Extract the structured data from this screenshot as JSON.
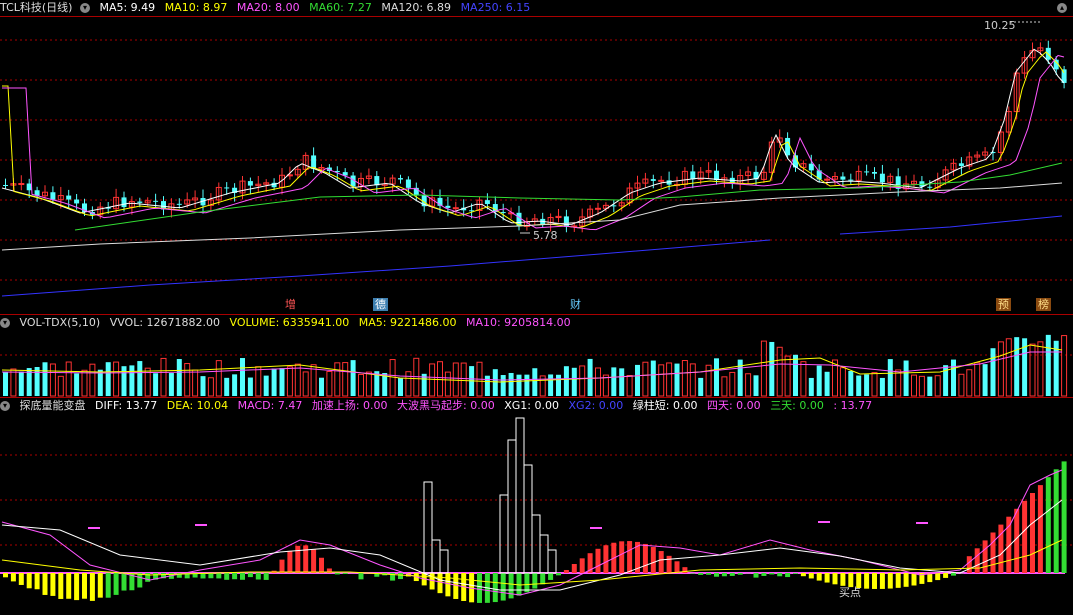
{
  "main_header": {
    "title": "TCL科技(日线)",
    "ma5": "MA5: 9.49",
    "ma10": "MA10: 8.97",
    "ma20": "MA20: 8.00",
    "ma60": "MA60: 7.27",
    "ma120": "MA120: 6.89",
    "ma250": "MA250: 6.15"
  },
  "main_annotations": {
    "high": "10.25",
    "low": "5.78",
    "marker_zeng": "增",
    "marker_de": "德",
    "marker_cai": "财",
    "marker_yu": "预",
    "marker_bang": "榜"
  },
  "vol_header": {
    "title": "VOL-TDX(5,10)",
    "vvol": "VVOL: 12671882.00",
    "volume": "VOLUME: 6335941.00",
    "ma5": "MA5: 9221486.00",
    "ma10": "MA10: 9205814.00"
  },
  "ind_header": {
    "title": "探底量能变盘",
    "diff": "DIFF: 13.77",
    "dea": "DEA: 10.04",
    "macd": "MACD: 7.47",
    "jiasu": "加速上扬: 0.00",
    "dabo": "大波黑马起步: 0.00",
    "xg1": "XG1: 0.00",
    "xg2": "XG2: 0.00",
    "lvzhu": "绿柱短: 0.00",
    "sitian": "四天: 0.00",
    "santian": "三天: 0.00",
    "last": ": 13.77"
  },
  "ind_annotations": {
    "buy_point": "买点"
  },
  "colors": {
    "up": "#ff3333",
    "down": "#54ffff",
    "ma5": "#ffffff",
    "ma10": "#ffff00",
    "ma20": "#ff55ff",
    "ma60": "#33dd33",
    "ma120": "#dddddd",
    "ma250": "#3333ff",
    "grid": "#aa0000"
  },
  "chart_data": [
    {
      "type": "candlestick",
      "title": "TCL科技(日线)",
      "y_annotations": {
        "high": 10.25,
        "low": 5.78
      },
      "series": [
        {
          "name": "MA5",
          "last": 9.49
        },
        {
          "name": "MA10",
          "last": 8.97
        },
        {
          "name": "MA20",
          "last": 8.0
        },
        {
          "name": "MA60",
          "last": 7.27
        },
        {
          "name": "MA120",
          "last": 6.89
        },
        {
          "name": "MA250",
          "last": 6.15
        }
      ]
    },
    {
      "type": "bar",
      "title": "VOL-TDX(5,10)",
      "series": [
        {
          "name": "VVOL",
          "last": 12671882.0
        },
        {
          "name": "VOLUME",
          "last": 6335941.0
        },
        {
          "name": "MA5",
          "last": 9221486.0
        },
        {
          "name": "MA10",
          "last": 9205814.0
        }
      ]
    },
    {
      "type": "bar",
      "title": "探底量能变盘",
      "series": [
        {
          "name": "DIFF",
          "last": 13.77
        },
        {
          "name": "DEA",
          "last": 10.04
        },
        {
          "name": "MACD",
          "last": 7.47
        }
      ]
    }
  ]
}
